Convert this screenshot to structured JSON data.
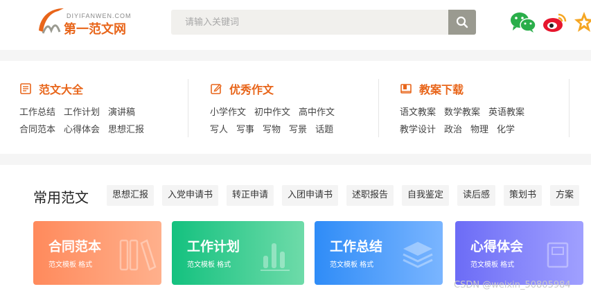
{
  "header": {
    "logo_small": "DIYIFANWEN.COM",
    "logo_big": "第一范文网",
    "search_placeholder": "请输入关键词"
  },
  "categories": [
    {
      "title": "范文大全",
      "icon": "document-list-icon",
      "row1": [
        "工作总结",
        "工作计划",
        "演讲稿"
      ],
      "row2": [
        "合同范本",
        "心得体会",
        "思想汇报"
      ]
    },
    {
      "title": "优秀作文",
      "icon": "edit-icon",
      "row1": [
        "小学作文",
        "初中作文",
        "高中作文"
      ],
      "row2": [
        "写人",
        "写事",
        "写物",
        "写景",
        "话题"
      ]
    },
    {
      "title": "教案下载",
      "icon": "book-icon",
      "row1": [
        "语文教案",
        "数学教案",
        "英语教案"
      ],
      "row2": [
        "教学设计",
        "政治",
        "物理",
        "化学"
      ]
    }
  ],
  "common": {
    "title": "常用范文",
    "tags": [
      "思想汇报",
      "入党申请书",
      "转正申请",
      "入团申请书",
      "述职报告",
      "自我鉴定",
      "读后感",
      "策划书",
      "方案"
    ],
    "cards": [
      {
        "title": "合同范本",
        "sub": "范文模板 格式",
        "color1": "#ff8a5c",
        "color2": "#ffb08c",
        "icon": "books-icon"
      },
      {
        "title": "工作计划",
        "sub": "范文模板 格式",
        "color1": "#14c17f",
        "color2": "#6edba9",
        "icon": "bar-chart-icon"
      },
      {
        "title": "工作总结",
        "sub": "范文模板 格式",
        "color1": "#2f8cf7",
        "color2": "#7ab5ff",
        "icon": "layers-icon"
      },
      {
        "title": "心得体会",
        "sub": "范文模板 格式",
        "color1": "#6c6cf6",
        "color2": "#a0a0ff",
        "icon": "notebook-icon"
      }
    ]
  },
  "watermark": "CSDN @weixin_50805984",
  "colors": {
    "accent": "#e8651a",
    "wechat": "#2aae4a",
    "weibo": "#e6162d",
    "star": "#f5a623"
  }
}
